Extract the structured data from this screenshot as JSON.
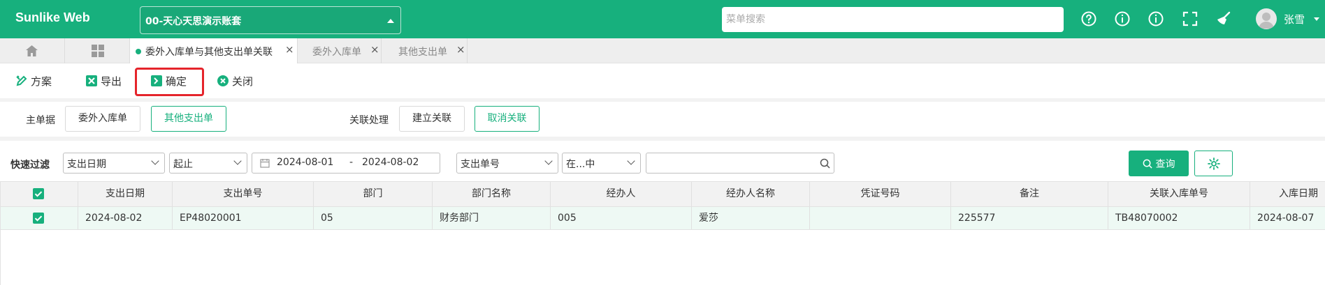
{
  "header": {
    "brand": "Sunlike Web",
    "account": "00-天心天思演示账套",
    "menu_search_placeholder": "菜单搜索",
    "user_name": "张雪"
  },
  "tabs": [
    {
      "label": "委外入库单与其他支出单关联",
      "active": true
    },
    {
      "label": "委外入库单",
      "active": false
    },
    {
      "label": "其他支出单",
      "active": false
    }
  ],
  "toolbar": {
    "scheme": "方案",
    "export": "导出",
    "confirm": "确定",
    "close": "关闭"
  },
  "relation": {
    "main_label": "主单据",
    "main_btn1": "委外入库单",
    "main_btn2": "其他支出单",
    "proc_label": "关联处理",
    "proc_btn1": "建立关联",
    "proc_btn2": "取消关联"
  },
  "filter": {
    "label": "快速过滤",
    "field": "支出日期",
    "op": "起止",
    "date_from": "2024-08-01",
    "date_sep": "-",
    "date_to": "2024-08-02",
    "field2": "支出单号",
    "op2": "在...中",
    "query": "查询"
  },
  "grid": {
    "columns": [
      "支出日期",
      "支出单号",
      "部门",
      "部门名称",
      "经办人",
      "经办人名称",
      "凭证号码",
      "备注",
      "关联入库单号",
      "入库日期"
    ],
    "rows": [
      [
        "2024-08-02",
        "EP48020001",
        "05",
        "财务部门",
        "005",
        "爱莎",
        "",
        "225577",
        "TB48070002",
        "2024-08-07"
      ]
    ]
  },
  "colors": {
    "primary": "#17b07d",
    "highlight": "#e5242b"
  }
}
